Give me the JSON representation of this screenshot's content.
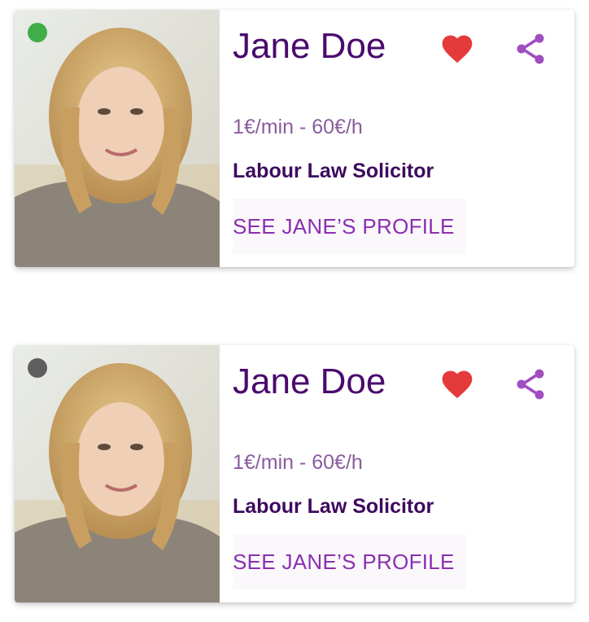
{
  "colors": {
    "online": "#3fae49",
    "offline": "#5f5f5f",
    "heart": "#e53a3a",
    "share": "#a04ec0",
    "name": "#4a0a6e",
    "accent": "#8b2fb1"
  },
  "cards": [
    {
      "status": "online",
      "name": "Jane Doe",
      "price": "1€/min - 60€/h",
      "specialty": "Labour Law Solicitor",
      "profile_label": "SEE JANE’S PROFILE",
      "favorite_icon": "heart-icon",
      "share_icon": "share-icon",
      "photo_icon": "portrait-photo"
    },
    {
      "status": "offline",
      "name": "Jane Doe",
      "price": "1€/min - 60€/h",
      "specialty": "Labour Law Solicitor",
      "profile_label": "SEE JANE’S PROFILE",
      "favorite_icon": "heart-icon",
      "share_icon": "share-icon",
      "photo_icon": "portrait-photo"
    }
  ]
}
